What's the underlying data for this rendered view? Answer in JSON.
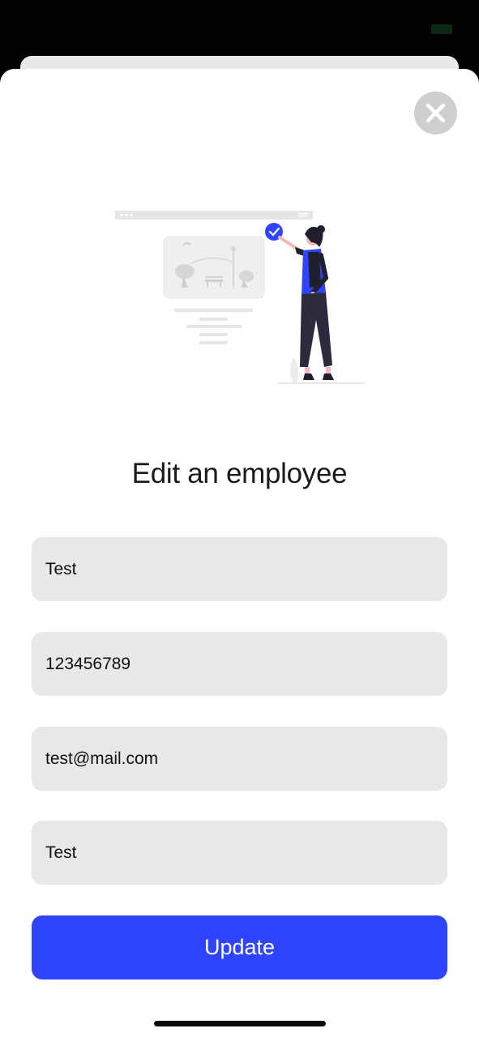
{
  "modal": {
    "title": "Edit an employee",
    "close_icon": "close-icon"
  },
  "form": {
    "name": {
      "value": "Test"
    },
    "phone": {
      "value": "123456789"
    },
    "email": {
      "value": "test@mail.com"
    },
    "role": {
      "value": "Test"
    },
    "submit_label": "Update"
  },
  "colors": {
    "accent": "#2f44ff",
    "field_bg": "#e8e8e8",
    "close_bg": "#cfcfcf"
  },
  "illustration_icon": "employee-checkmark-illustration"
}
